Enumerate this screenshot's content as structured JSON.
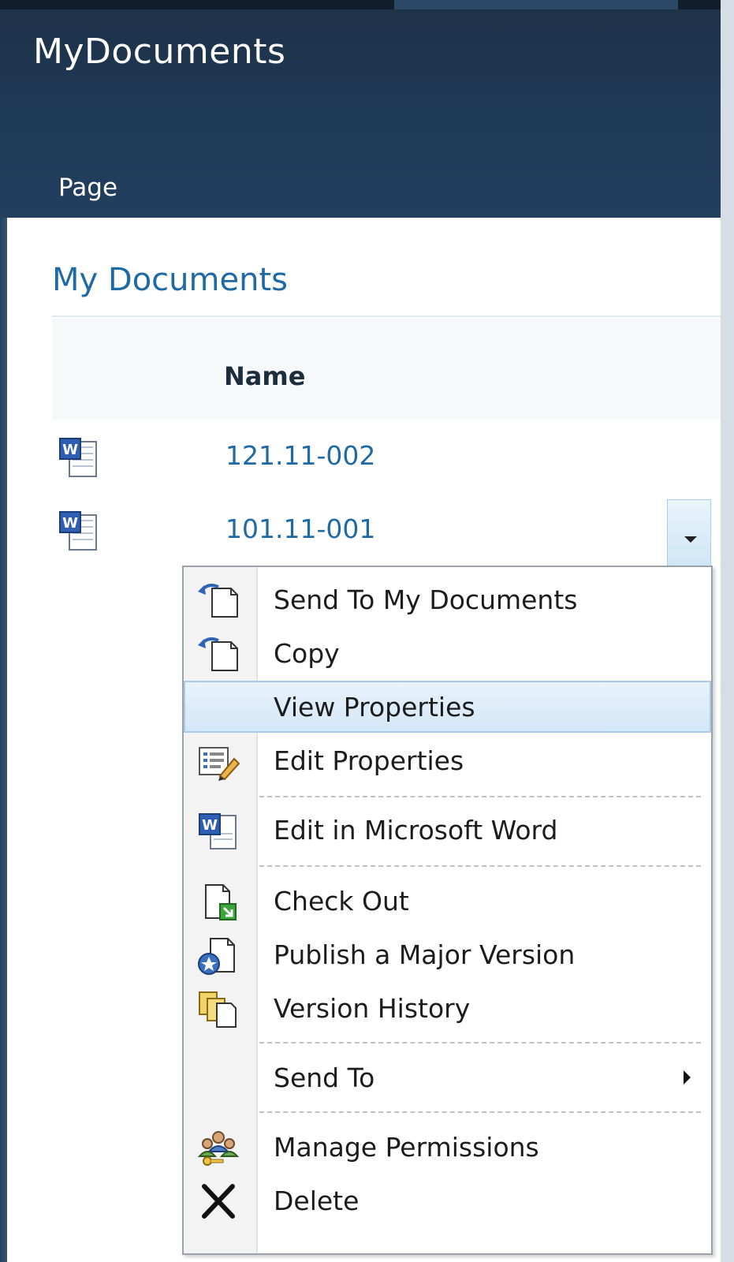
{
  "site": {
    "title": "MyDocuments",
    "ribbon_tab": "Page"
  },
  "webpart": {
    "title": "My Documents",
    "column_header": "Name",
    "documents": [
      {
        "name": "121.11-002",
        "icon": "word-document-icon"
      },
      {
        "name": "101.11-001",
        "icon": "word-document-icon"
      }
    ]
  },
  "context_menu": {
    "items": [
      {
        "label": "Send To My Documents",
        "icon": "send-to-icon"
      },
      {
        "label": "Copy",
        "icon": "copy-icon"
      },
      {
        "label": "View Properties",
        "icon": "",
        "highlighted": true
      },
      {
        "label": "Edit Properties",
        "icon": "edit-properties-icon"
      },
      {
        "label": "Edit in Microsoft Word",
        "icon": "word-document-icon"
      },
      {
        "label": "Check Out",
        "icon": "check-out-icon"
      },
      {
        "label": "Publish a Major Version",
        "icon": "publish-icon"
      },
      {
        "label": "Version History",
        "icon": "version-history-icon"
      },
      {
        "label": "Send To",
        "icon": "",
        "has_submenu": true
      },
      {
        "label": "Manage Permissions",
        "icon": "manage-permissions-icon"
      },
      {
        "label": "Delete",
        "icon": "delete-icon"
      }
    ]
  },
  "colors": {
    "header_bg": "#1f3a56",
    "link": "#1f6aa5",
    "menu_highlight": "#d4e7f7"
  }
}
